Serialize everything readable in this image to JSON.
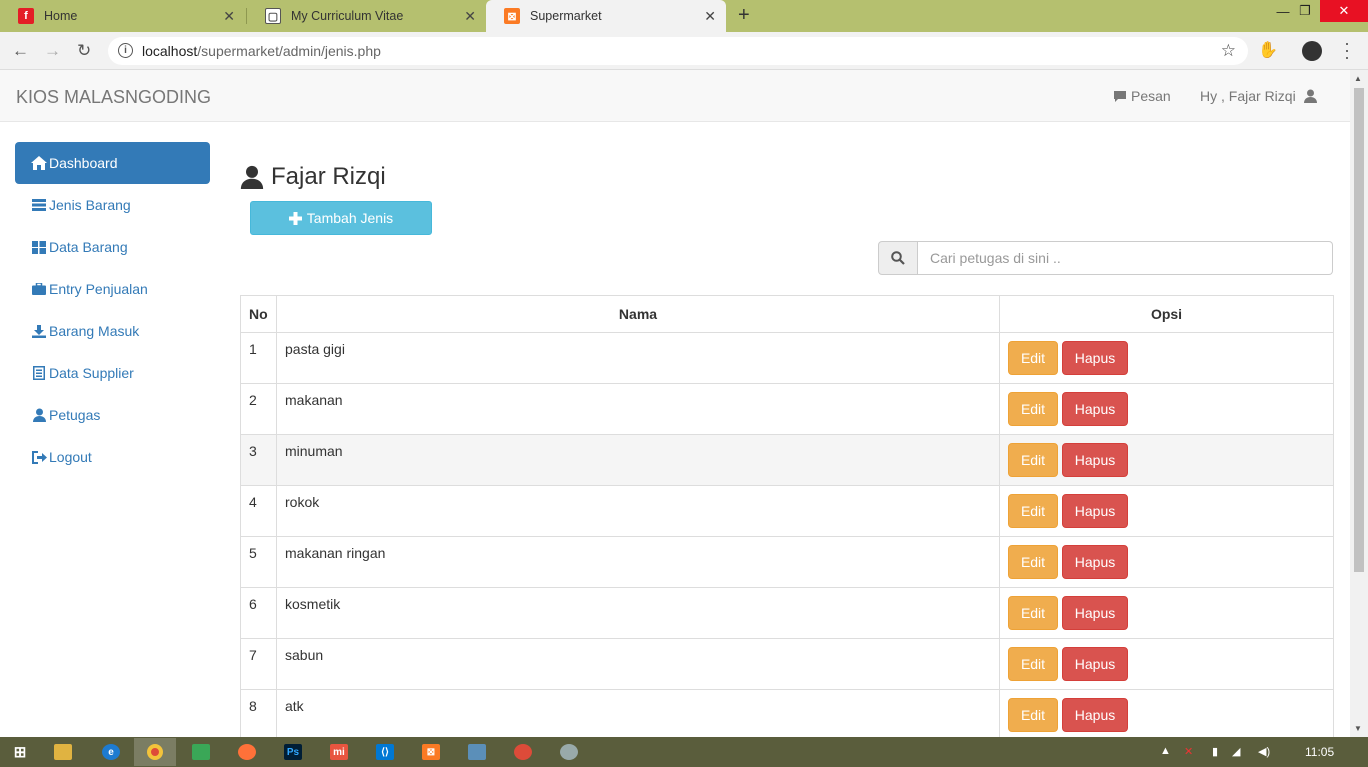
{
  "browser": {
    "tabs": [
      {
        "title": "Home",
        "color": "#e41e26",
        "glyph": "f"
      },
      {
        "title": "My Curriculum Vitae",
        "color": "#555555",
        "glyph": "▢"
      },
      {
        "title": "Supermarket",
        "color": "#fb7a24",
        "glyph": "⊠"
      }
    ],
    "url_host": "localhost",
    "url_path": "/supermarket/admin/jenis.php"
  },
  "navbar": {
    "brand": "KIOS MALASNGODING",
    "messages_label": "Pesan",
    "user_label": "Hy , Fajar Rizqi"
  },
  "sidebar": {
    "items": [
      {
        "label": "Dashboard",
        "icon": "home-icon"
      },
      {
        "label": "Jenis Barang",
        "icon": "list-icon"
      },
      {
        "label": "Data Barang",
        "icon": "th-large-icon"
      },
      {
        "label": "Entry Penjualan",
        "icon": "briefcase-icon"
      },
      {
        "label": "Barang Masuk",
        "icon": "download-icon"
      },
      {
        "label": "Data Supplier",
        "icon": "list-alt-icon"
      },
      {
        "label": "Petugas",
        "icon": "user-icon"
      },
      {
        "label": "Logout",
        "icon": "logout-icon"
      }
    ]
  },
  "main": {
    "title": "Fajar Rizqi",
    "add_button": "Tambah Jenis",
    "search_placeholder": "Cari petugas di sini .."
  },
  "table": {
    "headers": [
      "No",
      "Nama",
      "Opsi"
    ],
    "edit_label": "Edit",
    "delete_label": "Hapus",
    "rows": [
      {
        "no": "1",
        "nama": "pasta gigi"
      },
      {
        "no": "2",
        "nama": "makanan"
      },
      {
        "no": "3",
        "nama": "minuman"
      },
      {
        "no": "4",
        "nama": "rokok"
      },
      {
        "no": "5",
        "nama": "makanan ringan"
      },
      {
        "no": "6",
        "nama": "kosmetik"
      },
      {
        "no": "7",
        "nama": "sabun"
      },
      {
        "no": "8",
        "nama": "atk"
      }
    ]
  },
  "taskbar": {
    "clock": "11:05"
  }
}
